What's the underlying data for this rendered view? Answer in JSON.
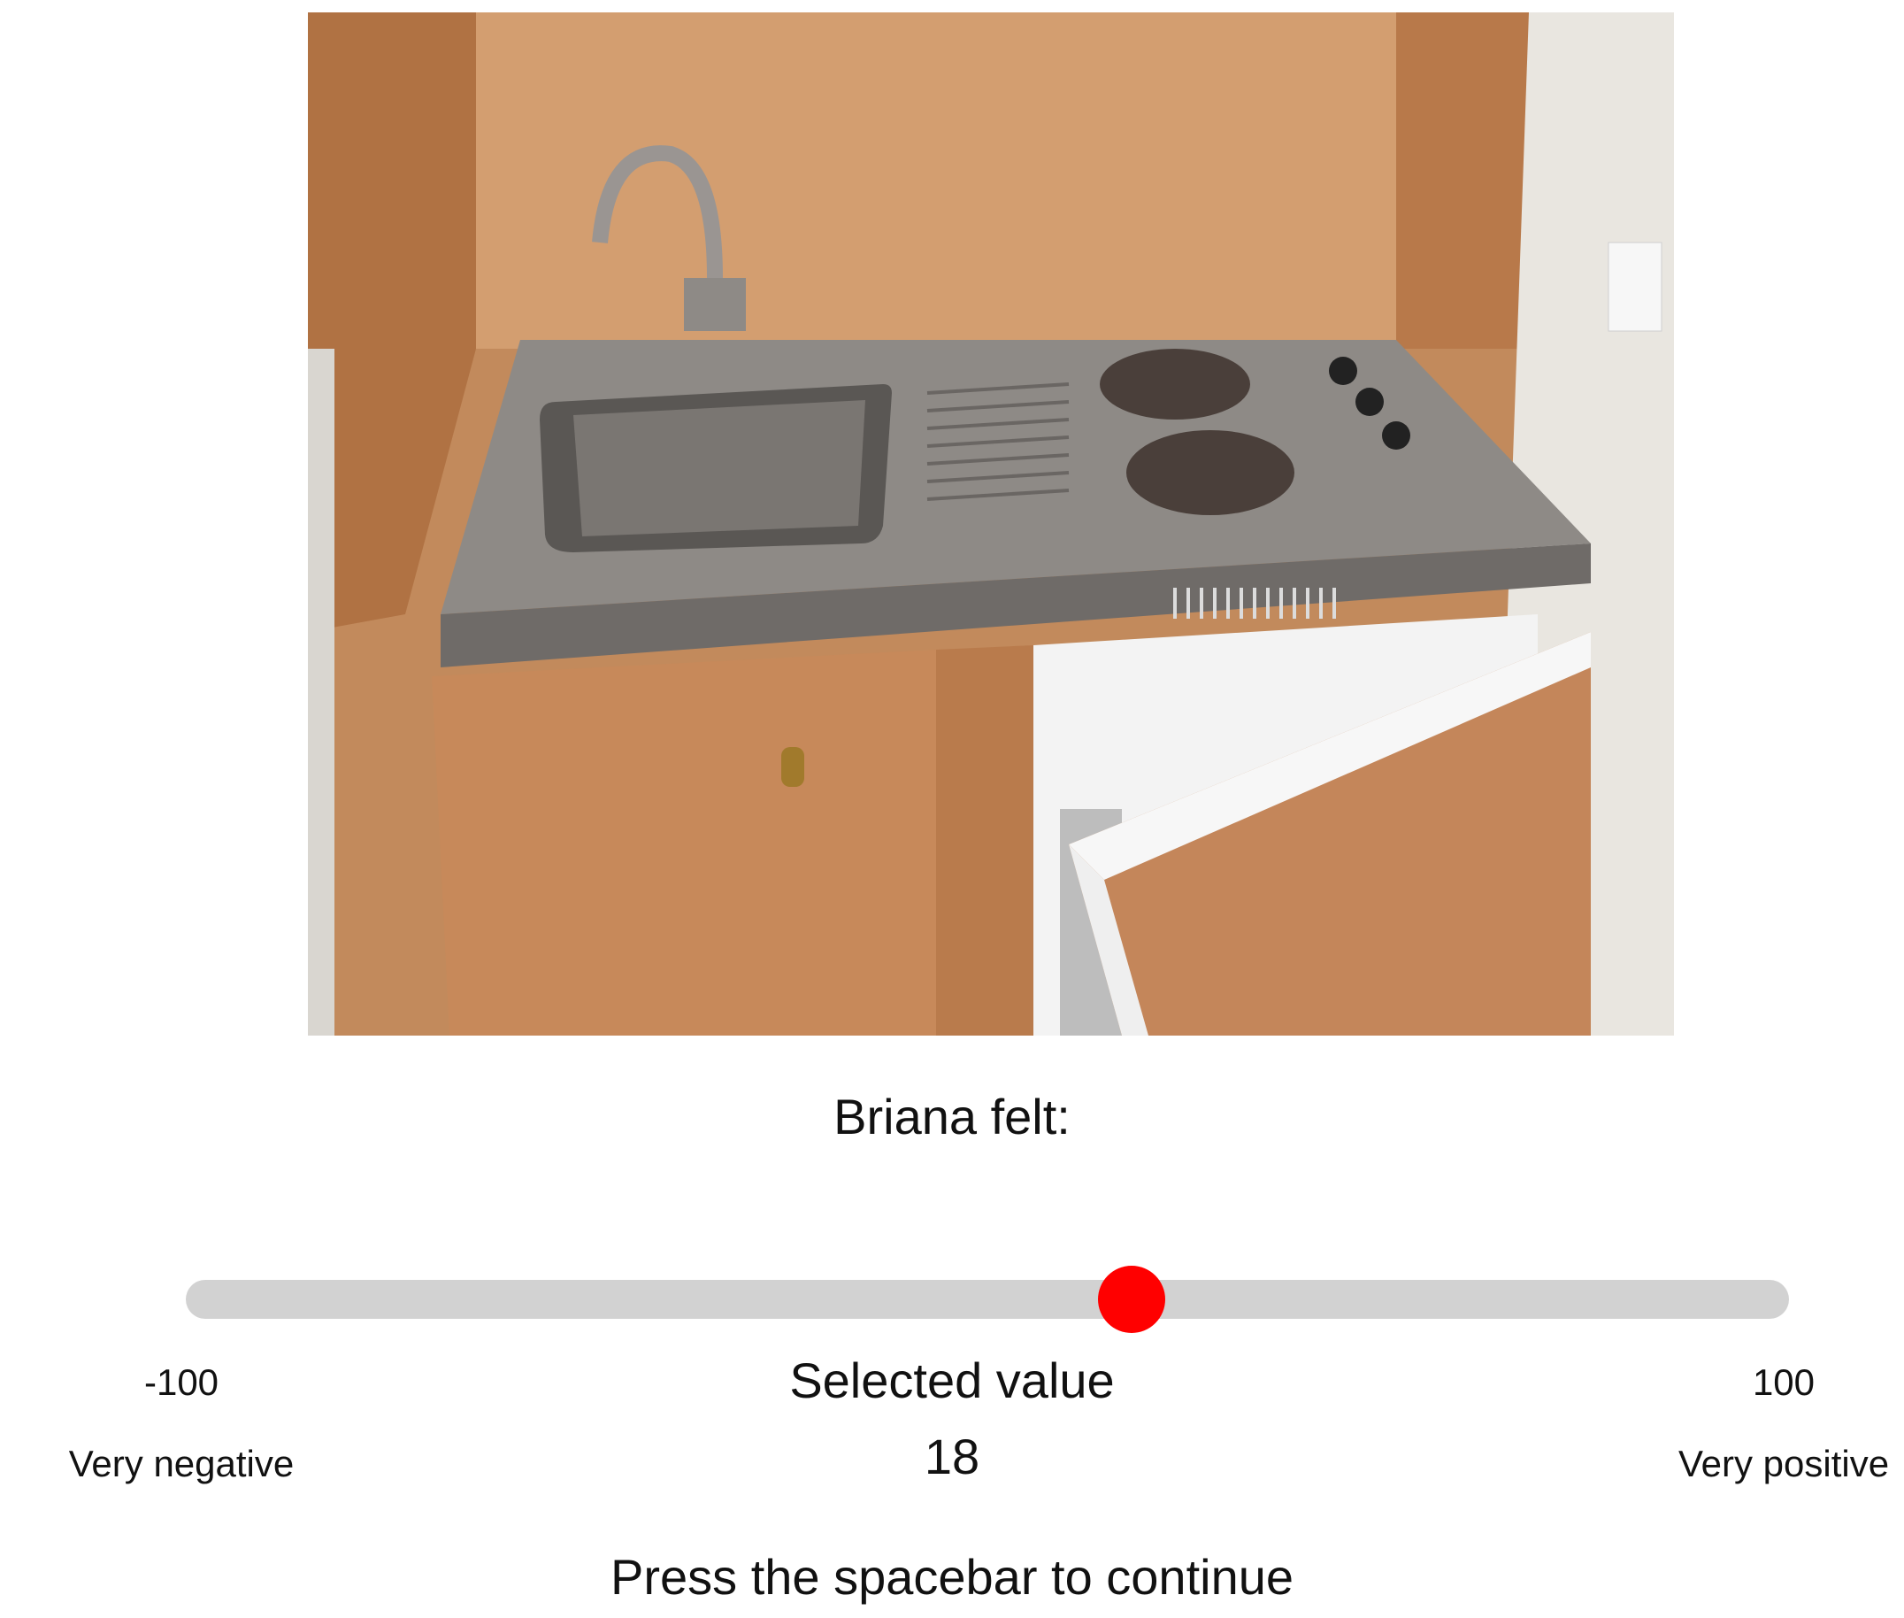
{
  "trial": {
    "image_description_icon": "kitchenette-photo",
    "prompt": "Briana felt:"
  },
  "slider": {
    "min": -100,
    "max": 100,
    "value": 18,
    "min_label": "-100",
    "max_label": "100",
    "min_anchor": "Very negative",
    "max_anchor": "Very positive",
    "selected_label": "Selected value",
    "selected_value": "18",
    "thumb_color": "#ff0000",
    "track_color": "#d2d2d2"
  },
  "instructions": {
    "continue": "Press the spacebar to continue"
  }
}
